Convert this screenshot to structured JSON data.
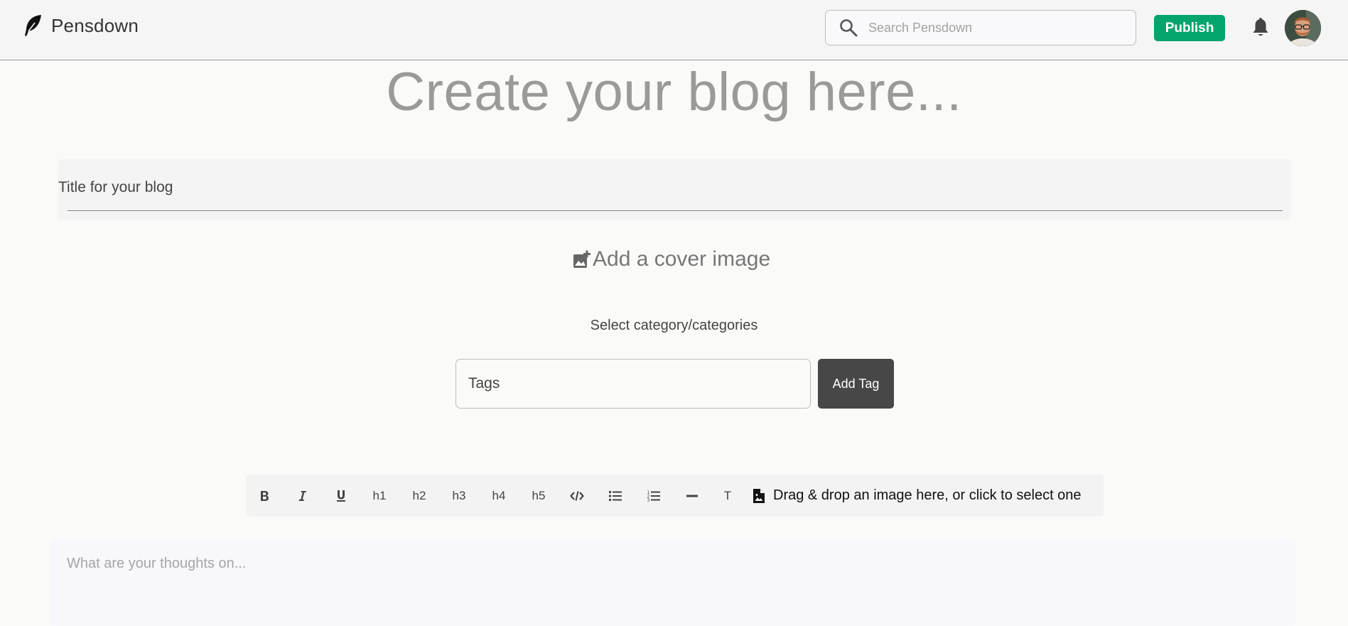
{
  "header": {
    "brand_name": "Pensdown",
    "search_placeholder": "Search Pensdown",
    "publish_label": "Publish"
  },
  "page": {
    "heading": "Create your blog here...",
    "title_placeholder": "Title for your blog",
    "cover_label": "Add a cover image",
    "category_label": "Select category/categories",
    "tags_placeholder": "Tags",
    "add_tag_label": "Add Tag"
  },
  "toolbar": {
    "h1": "h1",
    "h2": "h2",
    "h3": "h3",
    "h4": "h4",
    "h5": "h5",
    "text_label": "T",
    "dropzone_label": "Drag & drop an image here, or click to select one"
  },
  "editor": {
    "placeholder": "What are your thoughts on..."
  },
  "colors": {
    "accent": "#03a56c",
    "dark_button": "#474747"
  }
}
